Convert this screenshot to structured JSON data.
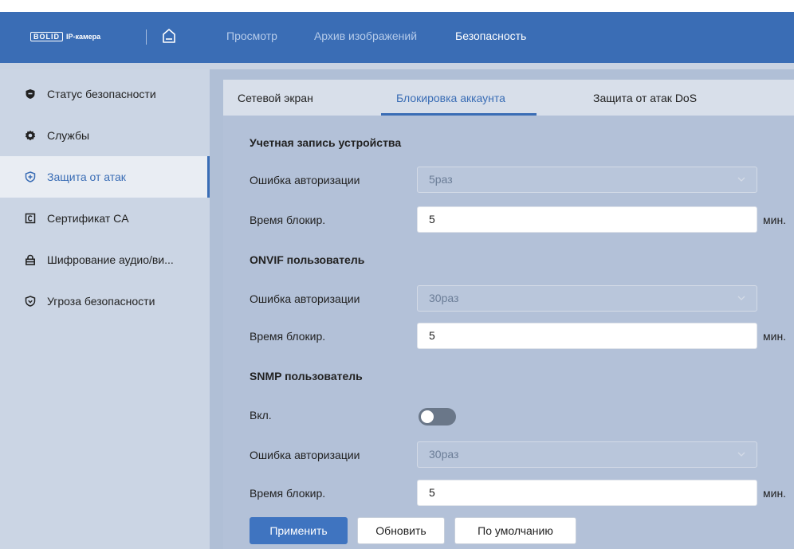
{
  "header": {
    "logo_brand": "BOLID",
    "logo_product": "IP-камера",
    "nav": [
      "Просмотр",
      "Архив изображений",
      "Безопасность"
    ],
    "active_nav": "Безопасность"
  },
  "sidebar": {
    "items": [
      {
        "label": "Статус безопасности",
        "icon": "shield-icon"
      },
      {
        "label": "Службы",
        "icon": "gear-icon"
      },
      {
        "label": "Защита от атак",
        "icon": "shield-plus-icon",
        "active": true
      },
      {
        "label": "Сертификат CA",
        "icon": "certificate-icon"
      },
      {
        "label": "Шифрование аудио/ви...",
        "icon": "lock-icon"
      },
      {
        "label": "Угроза безопасности",
        "icon": "shield-alert-icon"
      }
    ]
  },
  "tabs": {
    "items": [
      "Сетевой экран",
      "Блокировка аккаунта",
      "Защита от атак DoS"
    ],
    "active": "Блокировка аккаунта"
  },
  "form": {
    "device": {
      "title": "Учетная запись устройства",
      "auth_error_label": "Ошибка авторизации",
      "auth_error_value": "5раз",
      "lock_time_label": "Время блокир.",
      "lock_time_value": "5",
      "unit": "мин."
    },
    "onvif": {
      "title": "ONVIF пользователь",
      "auth_error_label": "Ошибка авторизации",
      "auth_error_value": "30раз",
      "lock_time_label": "Время блокир.",
      "lock_time_value": "5",
      "unit": "мин."
    },
    "snmp": {
      "title": "SNMP пользователь",
      "enable_label": "Вкл.",
      "enabled": false,
      "auth_error_label": "Ошибка авторизации",
      "auth_error_value": "30раз",
      "lock_time_label": "Время блокир.",
      "lock_time_value": "5",
      "unit": "мин."
    }
  },
  "buttons": {
    "apply": "Применить",
    "refresh": "Обновить",
    "default": "По умолчанию"
  },
  "colors": {
    "header": "#3a6db5",
    "accent": "#3a6db5",
    "content_bg": "#b3c1d8",
    "sidebar_bg": "#cbd5e4"
  }
}
